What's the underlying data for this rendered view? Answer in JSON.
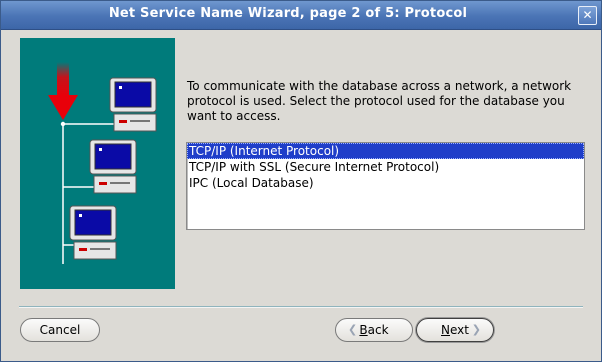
{
  "window": {
    "title": "Net Service Name Wizard, page 2 of 5: Protocol",
    "close_glyph": "✕"
  },
  "description": "To communicate with the database across a network, a network protocol is used.  Select the protocol used for the database you want to access.",
  "protocol_list": {
    "items": [
      {
        "label": "TCP/IP (Internet Protocol)",
        "selected": true
      },
      {
        "label": "TCP/IP with SSL (Secure Internet Protocol)",
        "selected": false
      },
      {
        "label": "IPC (Local Database)",
        "selected": false
      }
    ]
  },
  "buttons": {
    "cancel": "Cancel",
    "back_first": "B",
    "back_rest": "ack",
    "next_first": "N",
    "next_rest": "ext"
  },
  "colors": {
    "illustration_bg": "#007b7b",
    "selection": "#1f3ec9",
    "arrow_red": "#e8000a"
  },
  "icons": {
    "close": "close-icon",
    "back": "chevron-left-icon",
    "next": "chevron-right-icon"
  }
}
